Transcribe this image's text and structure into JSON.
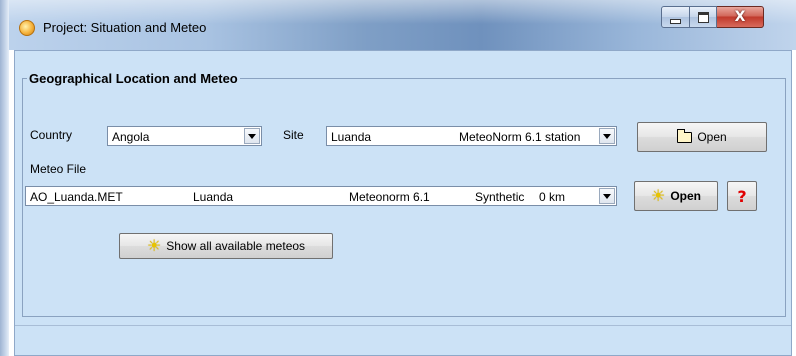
{
  "window": {
    "title": "Project: Situation and Meteo",
    "controls": {
      "minimize": "minimize",
      "maximize": "maximize",
      "close": "X"
    }
  },
  "group": {
    "legend": "Geographical Location and Meteo",
    "country_label": "Country",
    "country_value": "Angola",
    "site_label": "Site",
    "site_name": "Luanda",
    "site_source": "MeteoNorm 6.1 station",
    "open_site_label": "Open",
    "meteo_file_label": "Meteo File",
    "meteo": {
      "file": "AO_Luanda.MET",
      "site": "Luanda",
      "source": "Meteonorm 6.1",
      "type": "Synthetic",
      "distance": "0 km"
    },
    "open_meteo_label": "Open",
    "help_label": "?",
    "show_all_label": "Show all available meteos"
  },
  "colors": {
    "client_bg": "#cce2f6",
    "help_red": "#e00000",
    "sun_yellow": "#e8c400"
  },
  "icons": [
    "app-icon",
    "folder-open-icon",
    "sun-icon",
    "help-icon",
    "chevron-down-icon"
  ]
}
